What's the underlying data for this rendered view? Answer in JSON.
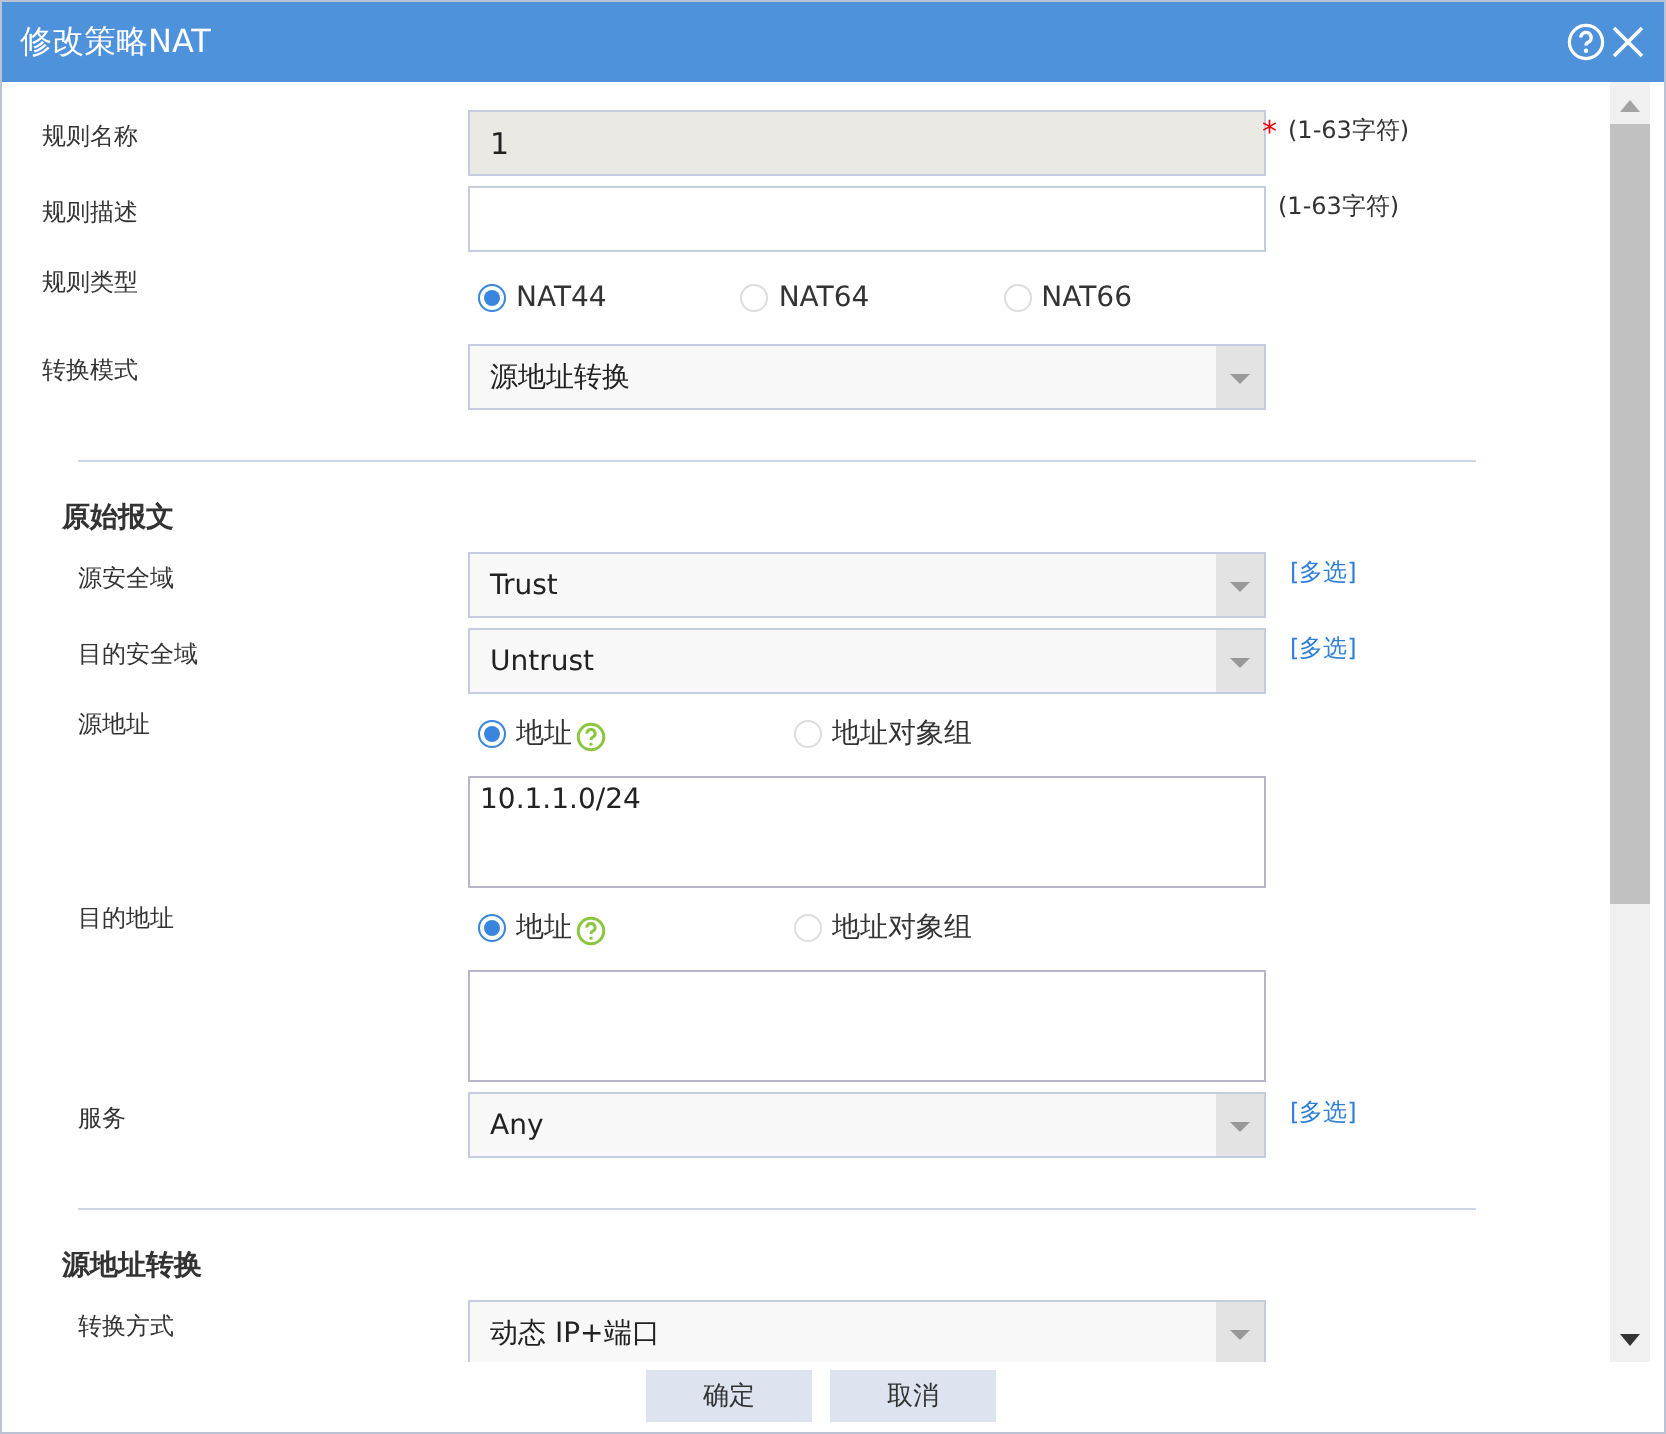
{
  "dialog": {
    "title": "修改策略NAT"
  },
  "rows": [
    {
      "kind": "text",
      "label": "规则名称",
      "value": "1",
      "disabled": true,
      "required_mark": "*",
      "hint": "(1-63字符)"
    },
    {
      "kind": "text",
      "label": "规则描述",
      "disabled": false,
      "hint": "(1-63字符)"
    },
    {
      "kind": "radio",
      "label": "规则类型",
      "options": [
        {
          "label": "NAT44",
          "selected": true
        },
        {
          "label": "NAT64",
          "selected": false
        },
        {
          "label": "NAT66",
          "selected": false
        }
      ]
    },
    {
      "kind": "select",
      "label": "转换模式",
      "value": "源地址转换"
    }
  ],
  "sections": [
    {
      "title": "原始报文",
      "rows": [
        {
          "kind": "select",
          "label": "源安全域",
          "value": "Trust",
          "link": "[多选]"
        },
        {
          "kind": "select",
          "label": "目的安全域",
          "value": "Untrust",
          "link": "[多选]"
        },
        {
          "kind": "address",
          "label": "源地址",
          "options": [
            {
              "label": "地址",
              "selected": true,
              "help": true
            },
            {
              "label": "地址对象组",
              "selected": false,
              "help": false
            }
          ],
          "value": "10.1.1.0/24"
        },
        {
          "kind": "address",
          "label": "目的地址",
          "options": [
            {
              "label": "地址",
              "selected": true,
              "help": true
            },
            {
              "label": "地址对象组",
              "selected": false,
              "help": false
            }
          ]
        },
        {
          "kind": "select",
          "label": "服务",
          "value": "Any",
          "link": "[多选]"
        }
      ]
    },
    {
      "title": "源地址转换",
      "rows": [
        {
          "kind": "select",
          "label": "转换方式",
          "value": "动态 IP+端口"
        }
      ]
    }
  ],
  "buttons": [
    "确定",
    "取消"
  ]
}
